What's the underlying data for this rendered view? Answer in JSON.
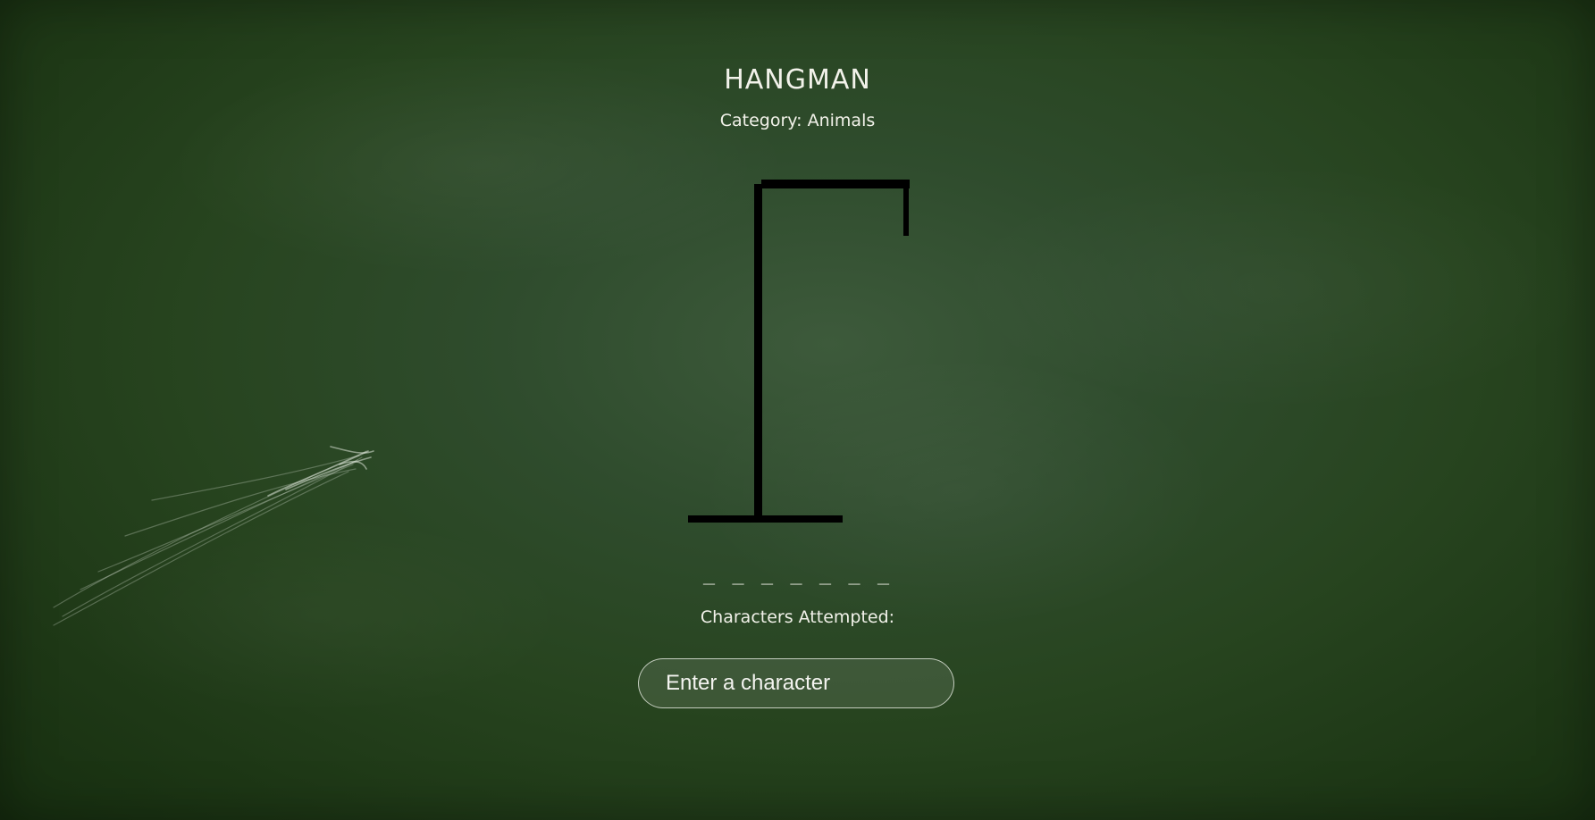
{
  "game": {
    "title": "HANGMAN",
    "category_label": "Category: Animals",
    "word_blanks": "_ _ _ _ _ _ _",
    "attempted_label": "Characters Attempted:",
    "attempted_chars": "",
    "input": {
      "placeholder": "Enter a character",
      "value": ""
    }
  },
  "hangman": {
    "parts_drawn": [
      "base",
      "pole",
      "beam",
      "rope"
    ],
    "color": "#000000"
  },
  "colors": {
    "board": "#2c4a27",
    "chalk_text": "#f2f2ea"
  }
}
